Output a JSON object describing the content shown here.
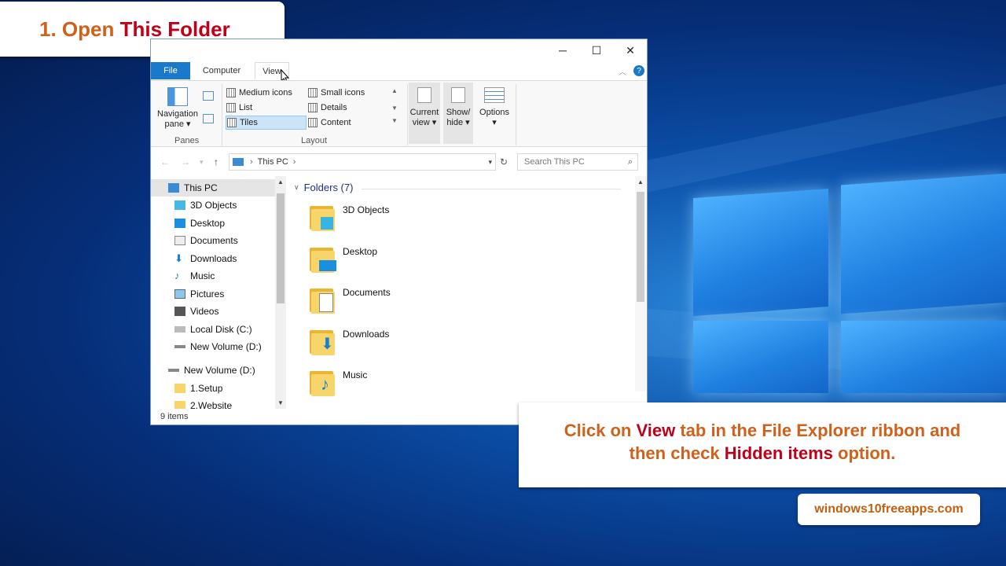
{
  "title_banner": {
    "number": "1.",
    "open": "Open",
    "this_folder": "This Folder"
  },
  "window": {
    "controls": {
      "minimize": "─",
      "maximize": "☐",
      "close": "✕"
    },
    "tabs": [
      {
        "label": "File"
      },
      {
        "label": "Computer"
      },
      {
        "label": "View"
      }
    ],
    "ribbon": {
      "panes": {
        "navigation_pane": "Navigation",
        "navigation_pane_2": "pane",
        "group_label": "Panes"
      },
      "layout": {
        "items": [
          "Medium icons",
          "List",
          "Tiles",
          "Small icons",
          "Details",
          "Content"
        ],
        "group_label": "Layout"
      },
      "current_view": [
        "Current",
        "view"
      ],
      "show_hide": [
        "Show/",
        "hide"
      ],
      "options": "Options"
    },
    "address": {
      "location": "This PC",
      "search_placeholder": "Search This PC"
    },
    "sidebar": [
      "This PC",
      "3D Objects",
      "Desktop",
      "Documents",
      "Downloads",
      "Music",
      "Pictures",
      "Videos",
      "Local Disk (C:)",
      "New Volume (D:)",
      "New Volume (D:)",
      "1.Setup",
      "2.Website"
    ],
    "folders_header": "Folders (7)",
    "folders": [
      "3D Objects",
      "Desktop",
      "Documents",
      "Downloads",
      "Music"
    ],
    "status": "9 items"
  },
  "description": {
    "part1": "Click on",
    "view": "View",
    "part2": "tab in the File Explorer ribbon and",
    "part3": "then check",
    "hidden": "Hidden items",
    "part4": "option."
  },
  "site": "windows10freeapps.com",
  "colors": {
    "accent_blue": "#1979ca",
    "orange": "#d0601a",
    "red": "#c00018"
  }
}
